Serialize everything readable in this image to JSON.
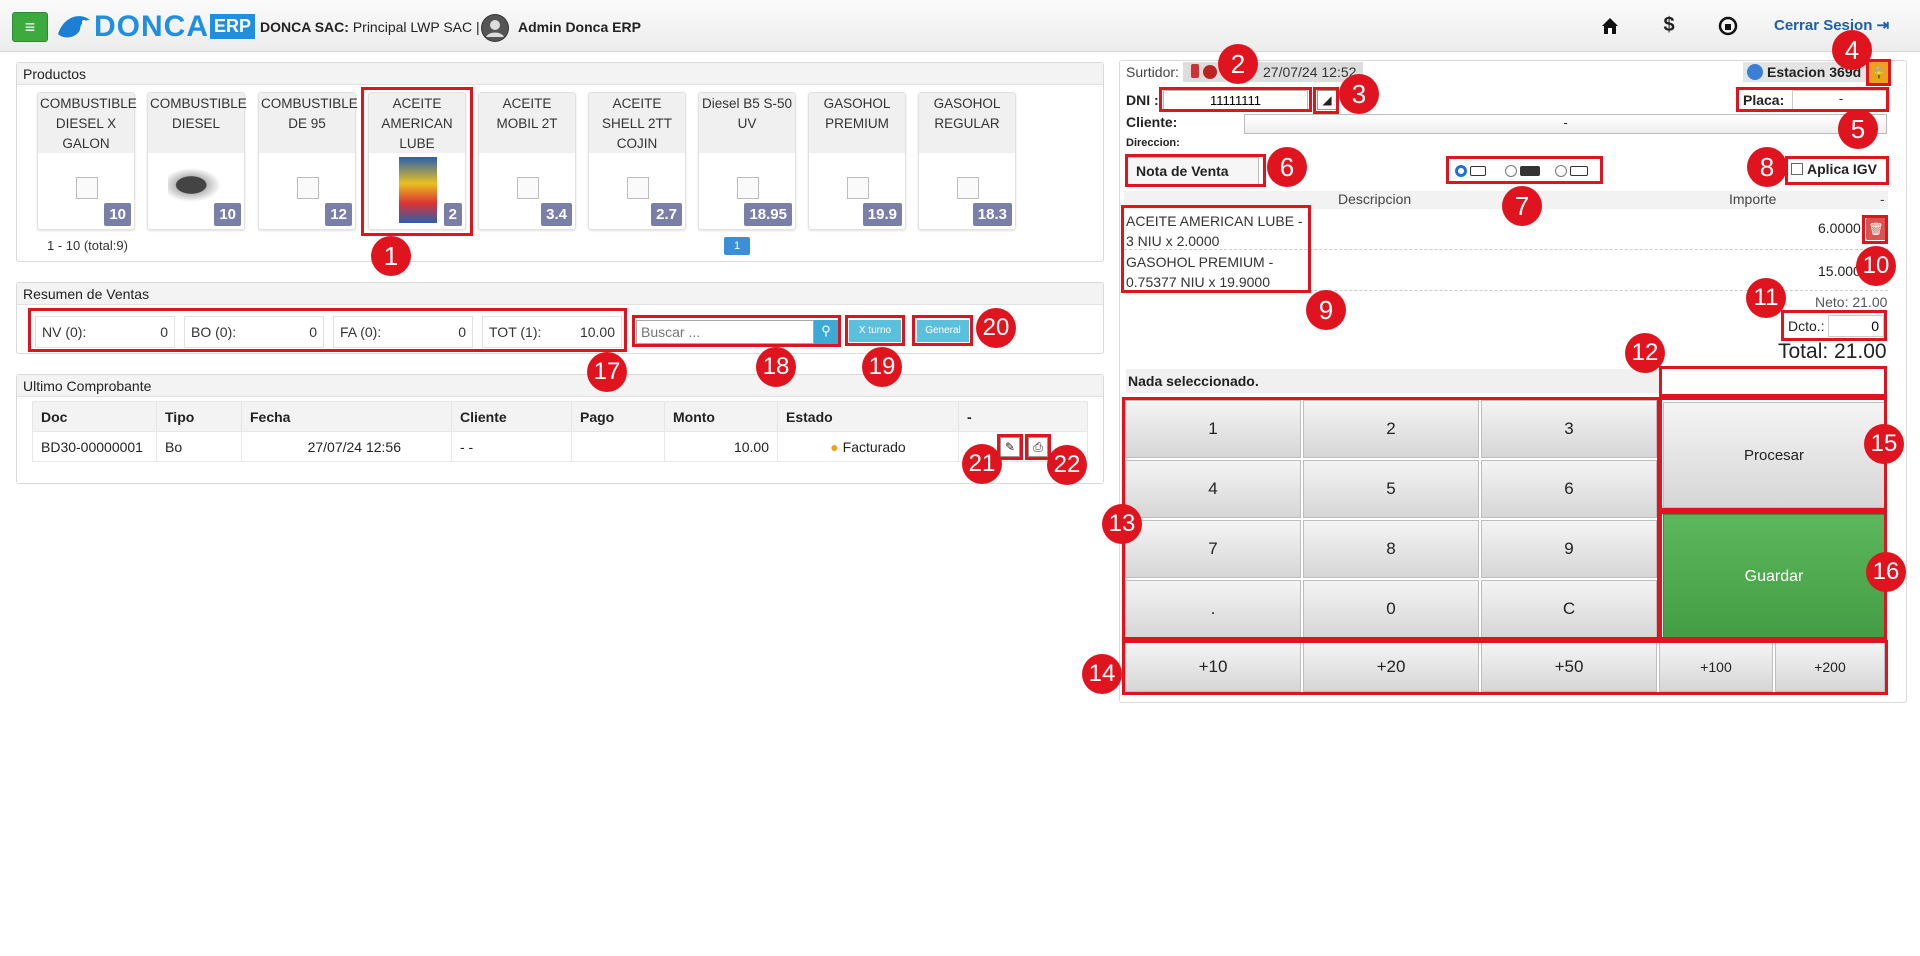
{
  "header": {
    "company_label": "DONCA SAC:",
    "company_value": "Principal LWP SAC |",
    "user": "Admin Donca ERP",
    "logo_text": "DONCA",
    "logo_erp": "ERP",
    "logout": "Cerrar Sesion",
    "menu_icon": "≡"
  },
  "products": {
    "title": "Productos",
    "pagination": "1 - 10 (total:9)",
    "page": "1",
    "items": [
      {
        "name": "COMBUSTIBLE DIESEL X GALON",
        "price": "10"
      },
      {
        "name": "COMBUSTIBLE DIESEL",
        "price": "10"
      },
      {
        "name": "COMBUSTIBLE DE 95",
        "price": "12"
      },
      {
        "name": "ACEITE AMERICAN LUBE",
        "price": "2"
      },
      {
        "name": "ACEITE MOBIL 2T",
        "price": "3.4"
      },
      {
        "name": "ACEITE SHELL 2TT COJIN",
        "price": "2.7"
      },
      {
        "name": "Diesel B5 S-50 UV",
        "price": "18.95"
      },
      {
        "name": "GASOHOL PREMIUM",
        "price": "19.9"
      },
      {
        "name": "GASOHOL REGULAR",
        "price": "18.3"
      }
    ]
  },
  "summary": {
    "title": "Resumen de Ventas",
    "boxes": [
      {
        "label": "NV (0):",
        "value": "0"
      },
      {
        "label": "BO (0):",
        "value": "0"
      },
      {
        "label": "FA (0):",
        "value": "0"
      },
      {
        "label": "TOT (1):",
        "value": "10.00"
      }
    ],
    "search_placeholder": "Buscar ...",
    "xturno": "X turno",
    "general": "General"
  },
  "last": {
    "title": "Ultimo Comprobante",
    "columns": [
      "Doc",
      "Tipo",
      "Fecha",
      "Cliente",
      "Pago",
      "Monto",
      "Estado",
      "-"
    ],
    "row": {
      "doc": "BD30-00000001",
      "tipo": "Bo",
      "fecha": "27/07/24 12:56",
      "cliente": "- -",
      "pago": "",
      "monto": "10.00",
      "estado": "Facturado"
    }
  },
  "right": {
    "surtidor_label": "Surtidor:",
    "datetime": "27/07/24 12:52",
    "estacion": "Estacion 369d",
    "dni_label": "DNI :",
    "dni_value": "11111111",
    "placa_label": "Placa:",
    "placa_value": "-",
    "cliente_label": "Cliente:",
    "cliente_value": "-",
    "direccion_label": "Direccion:",
    "doc_type": "Nota de Venta",
    "igv_label": "Aplica IGV",
    "desc_header": "Descripcion",
    "importe_header": "Importe",
    "dash": "-",
    "items": [
      {
        "line1": "ACEITE AMERICAN LUBE -",
        "line2": "3 NIU x 2.0000",
        "amount": "6.0000"
      },
      {
        "line1": "GASOHOL PREMIUM -",
        "line2": "0.75377 NIU x 19.9000",
        "amount": "15.0000"
      }
    ],
    "neto": "Neto: 21.00",
    "dcto_label": "Dcto.:",
    "dcto_value": "0",
    "total": "Total: 21.00",
    "nada": "Nada seleccionado.",
    "keys": [
      "1",
      "2",
      "3",
      "4",
      "5",
      "6",
      "7",
      "8",
      "9",
      ".",
      "0",
      "C"
    ],
    "quick": [
      "+10",
      "+20",
      "+50",
      "+100",
      "+200"
    ],
    "procesar": "Procesar",
    "guardar": "Guardar"
  },
  "markers": [
    "1",
    "2",
    "3",
    "4",
    "5",
    "6",
    "7",
    "8",
    "9",
    "10",
    "11",
    "12",
    "13",
    "14",
    "15",
    "16",
    "17",
    "18",
    "19",
    "20",
    "21",
    "22"
  ],
  "colors": {
    "accent_green": "#3daa3d",
    "guardar_green": "#4cae4c",
    "price_badge": "#7b7fa8",
    "marker_red": "#e0141e",
    "link_blue": "#1f5fa8",
    "btn_blue": "#5bc0de"
  }
}
